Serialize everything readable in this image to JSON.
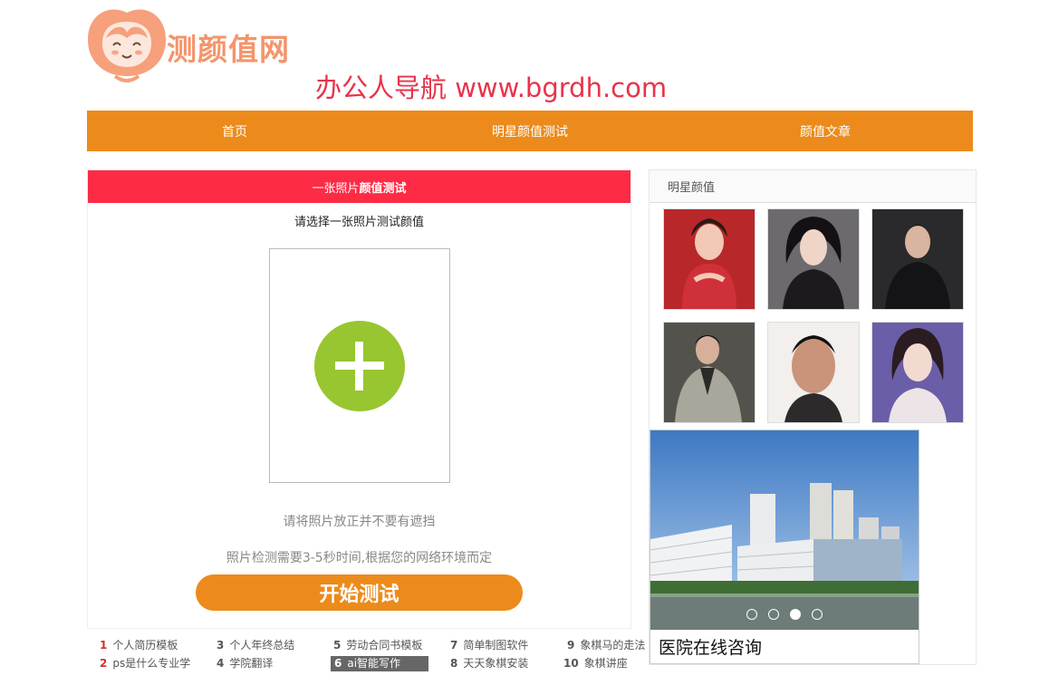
{
  "header": {
    "logo_text": "测颜值网",
    "watermark": "办公人导航 www.bgrdh.com"
  },
  "nav": {
    "items": [
      "首页",
      "明星颜值测试",
      "颜值文章"
    ]
  },
  "test": {
    "head_prefix": "一张照片",
    "head_bold": "颜值测试",
    "subtitle": "请选择一张照片测试颜值",
    "tip1": "请将照片放正并不要有遮挡",
    "tip2": "照片检测需要3-5秒时间,根据您的网络环境而定",
    "start_label": "开始测试"
  },
  "links": [
    {
      "num": "1",
      "text": "个人简历模板"
    },
    {
      "num": "2",
      "text": "ps是什么专业学"
    },
    {
      "num": "3",
      "text": "个人年终总结"
    },
    {
      "num": "4",
      "text": "学院翻译"
    },
    {
      "num": "5",
      "text": "劳动合同书模板"
    },
    {
      "num": "6",
      "text": "ai智能写作"
    },
    {
      "num": "7",
      "text": "简单制图软件"
    },
    {
      "num": "8",
      "text": "天天象棋安装"
    },
    {
      "num": "9",
      "text": "象棋马的走法"
    },
    {
      "num": "10",
      "text": "象棋讲座"
    }
  ],
  "stars": {
    "title": "明星颜值"
  },
  "banner": {
    "caption": "医院在线咨询",
    "active_dot": 3
  }
}
